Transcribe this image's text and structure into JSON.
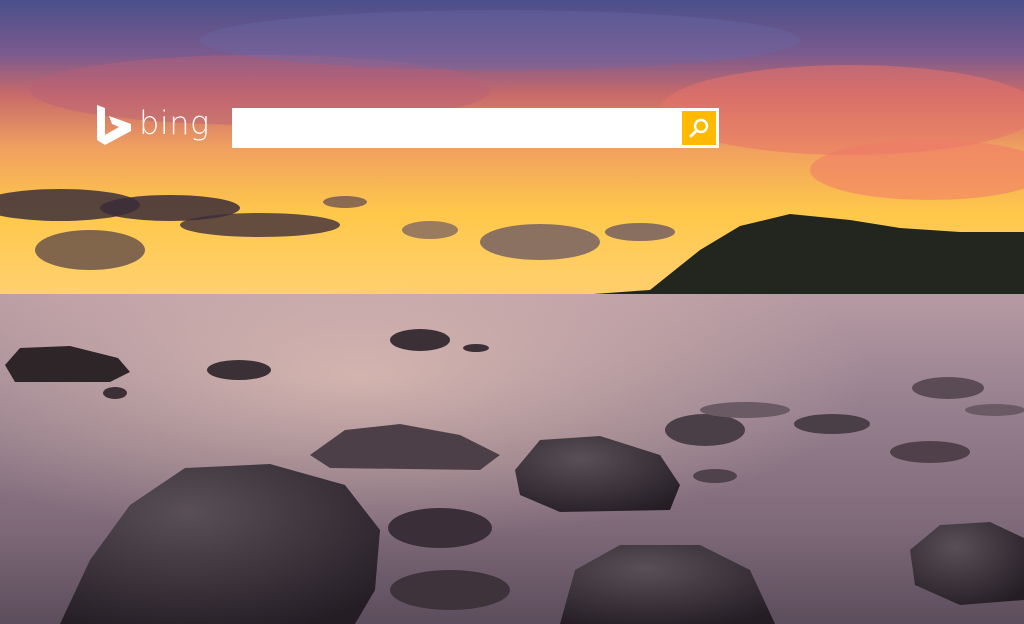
{
  "brand": {
    "name": "bing",
    "logo_icon": "bing-b-icon",
    "text_color": "#ffffff"
  },
  "search": {
    "value": "",
    "placeholder": "",
    "button_icon": "search-icon",
    "button_color": "#ffba00"
  },
  "background": {
    "icon": "sunset-beach-rocks-image"
  }
}
